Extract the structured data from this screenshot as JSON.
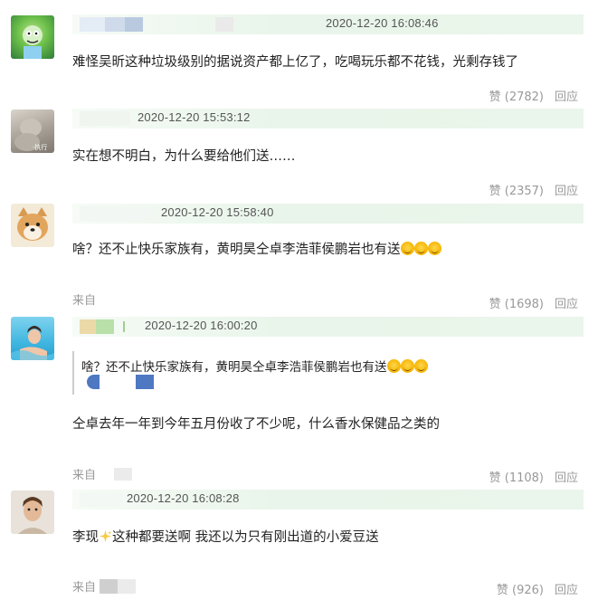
{
  "comments": [
    {
      "timestamp": "2020-12-20 16:08:46",
      "text": "难怪吴昕这种垃圾级别的据说资产都上亿了，吃喝玩乐都不花钱，光剩存钱了",
      "like_label": "赞 (2782)",
      "reply_label": "回应",
      "avatar": "cartoon-avatar"
    },
    {
      "timestamp": "2020-12-20 15:53:12",
      "text": "实在想不明白，为什么要给他们送……",
      "like_label": "赞 (2357)",
      "reply_label": "回应",
      "avatar": "photo-avatar"
    },
    {
      "timestamp": "2020-12-20 15:58:40",
      "text": "啥？还不止快乐家族有，黄明昊仝卓李浩菲侯鹏岩也有送",
      "emoji_count": 3,
      "source_label": "来自",
      "like_label": "赞 (1698)",
      "reply_label": "回应",
      "avatar": "dog-avatar"
    },
    {
      "timestamp": "2020-12-20 16:00:20",
      "quote_text": "啥？还不止快乐家族有，黄明昊仝卓李浩菲侯鹏岩也有送",
      "quote_emoji_count": 3,
      "text": "仝卓去年一年到今年五月份收了不少呢，什么香水保健品之类的",
      "source_label": "来自",
      "like_label": "赞 (1108)",
      "reply_label": "回应",
      "avatar": "swimmer-avatar"
    },
    {
      "timestamp": "2020-12-20 16:08:28",
      "text_before": "李现",
      "text_after": "这种都要送啊 我还以为只有刚出道的小爱豆送",
      "source_label": "来自",
      "like_label": "赞 (926)",
      "reply_label": "回应",
      "avatar": "man-avatar"
    }
  ],
  "colors": {
    "header_bg": "#eaf5eb",
    "meta_text": "#999999",
    "body_text": "#222222"
  }
}
